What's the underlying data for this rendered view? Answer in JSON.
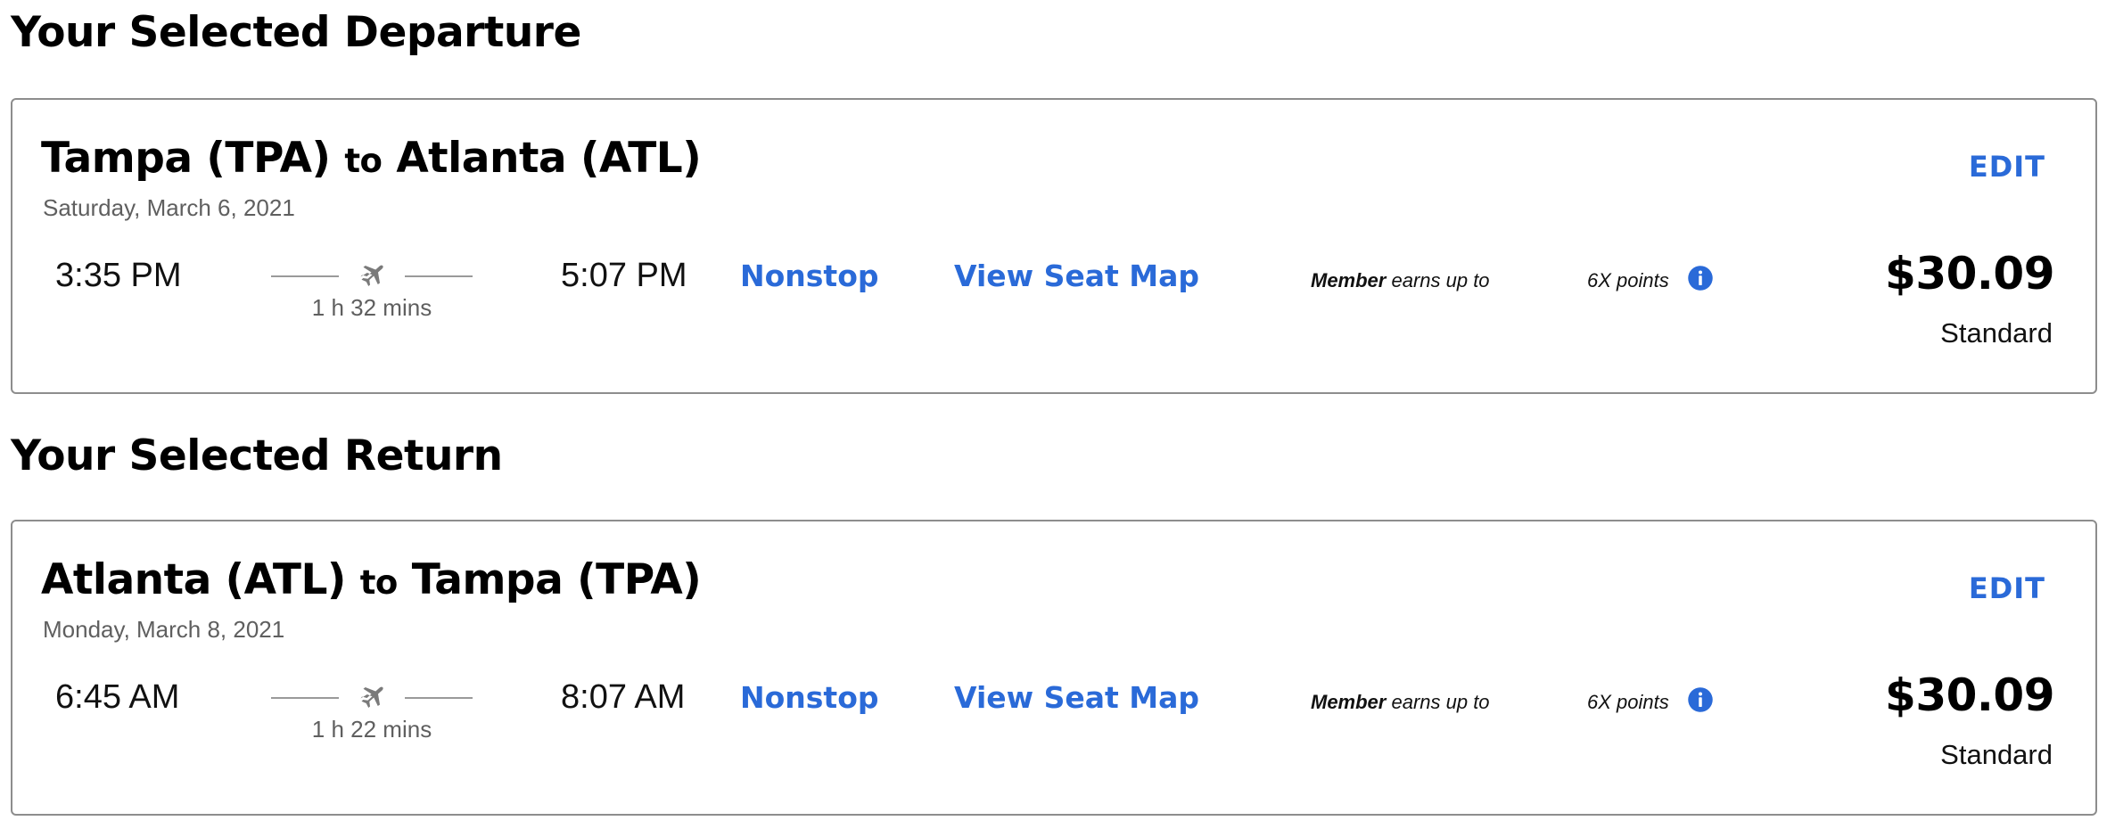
{
  "departure": {
    "heading": "Your Selected Departure",
    "origin": "Tampa (TPA)",
    "connector": "to",
    "destination": "Atlanta (ATL)",
    "date": "Saturday, March 6, 2021",
    "edit_label": "EDIT",
    "depart_time": "3:35 PM",
    "arrive_time": "5:07 PM",
    "duration": "1 h 32 mins",
    "stops": "Nonstop",
    "seat_map_label": "View Seat Map",
    "member_label": "Member",
    "earns_text": " earns up to",
    "points": "6X points",
    "price": "$30.09",
    "fare_class": "Standard"
  },
  "return": {
    "heading": "Your Selected Return",
    "origin": "Atlanta (ATL)",
    "connector": "to",
    "destination": "Tampa (TPA)",
    "date": "Monday, March 8, 2021",
    "edit_label": "EDIT",
    "depart_time": "6:45 AM",
    "arrive_time": "8:07 AM",
    "duration": "1 h 22 mins",
    "stops": "Nonstop",
    "seat_map_label": "View Seat Map",
    "member_label": "Member",
    "earns_text": " earns up to",
    "points": "6X points",
    "price": "$30.09",
    "fare_class": "Standard"
  },
  "icons": {
    "plane": "airplane-icon",
    "info": "info-icon"
  },
  "colors": {
    "link": "#2a6ad8",
    "info_icon": "#2a6ad8",
    "border": "#8d8d8d",
    "muted_text": "#5f5f5f"
  }
}
